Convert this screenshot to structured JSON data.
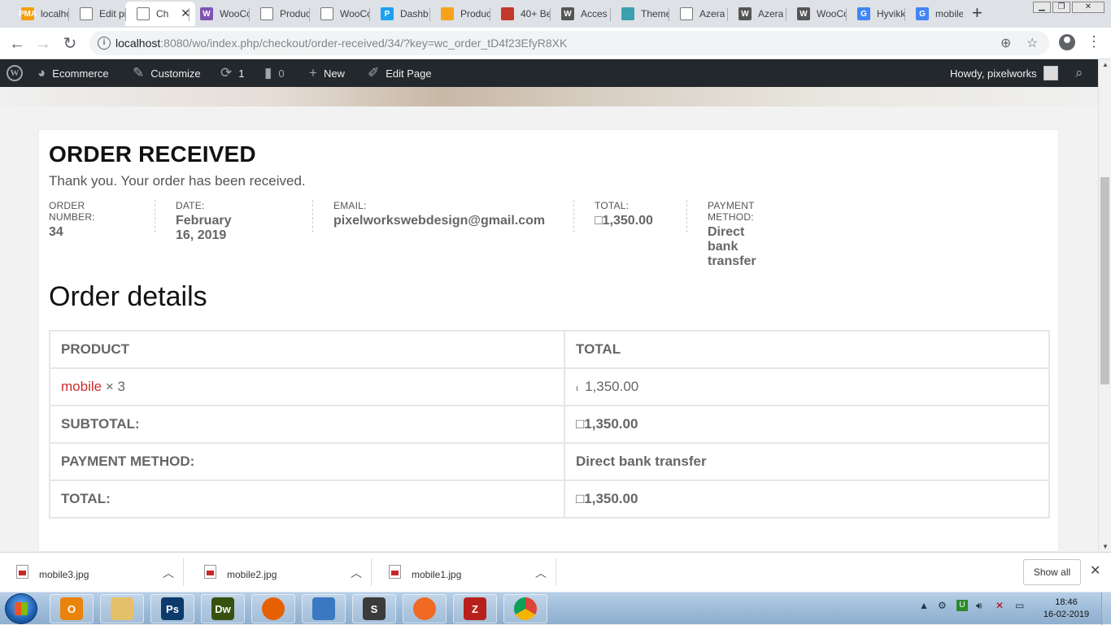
{
  "browser": {
    "tabs": [
      {
        "title": "localho",
        "icon": "PMA",
        "color": "#f59e0b"
      },
      {
        "title": "Edit pro",
        "icon": "",
        "color": "#ffffff"
      },
      {
        "title": "Ch",
        "icon": "",
        "color": "#ffffff",
        "active": true
      },
      {
        "title": "WooCo",
        "icon": "W",
        "color": "#7f54b3"
      },
      {
        "title": "Produc",
        "icon": "",
        "color": "#ffffff"
      },
      {
        "title": "WooCo",
        "icon": "",
        "color": "#ffffff"
      },
      {
        "title": "Dashb",
        "icon": "P",
        "color": "#1da1f2"
      },
      {
        "title": "Produc",
        "icon": "",
        "color": "#f6a21b"
      },
      {
        "title": "40+ Be",
        "icon": "",
        "color": "#c0392b"
      },
      {
        "title": "Acces",
        "icon": "W",
        "color": "#555555"
      },
      {
        "title": "Theme",
        "icon": "",
        "color": "#3aa0b0"
      },
      {
        "title": "Azera",
        "icon": "",
        "color": "#ffffff"
      },
      {
        "title": "Azera",
        "icon": "W",
        "color": "#555555"
      },
      {
        "title": "WooCo",
        "icon": "W",
        "color": "#555555"
      },
      {
        "title": "Hyvikk",
        "icon": "G",
        "color": "#4285f4"
      },
      {
        "title": "mobile",
        "icon": "G",
        "color": "#4285f4"
      }
    ],
    "tab_close": "✕",
    "new_tab": "+",
    "window_controls": [
      "▁",
      "❐",
      "✕"
    ],
    "url_host": "localhost",
    "url_rest": ":8080/wo/index.php/checkout/order-received/34/?key=wc_order_tD4f23EfyR8XK"
  },
  "adminbar": {
    "site_name": "Ecommerce",
    "customize": "Customize",
    "updates_count": "1",
    "comments_count": "0",
    "new_label": "New",
    "edit_page": "Edit Page",
    "howdy": "Howdy, pixelworks"
  },
  "order": {
    "title": "ORDER RECEIVED",
    "thanks": "Thank you. Your order has been received.",
    "overview": [
      {
        "label": "ORDER NUMBER:",
        "value": "34"
      },
      {
        "label": "DATE:",
        "value": "February 16, 2019"
      },
      {
        "label": "EMAIL:",
        "value": "pixelworkswebdesign@gmail.com"
      },
      {
        "label": "TOTAL:",
        "value": "□1,350.00"
      },
      {
        "label": "PAYMENT METHOD:",
        "value": "Direct bank transfer"
      }
    ]
  },
  "details": {
    "title": "Order details",
    "col_product": "PRODUCT",
    "col_total": "TOTAL",
    "item_name": "mobile",
    "item_qty": "× 3",
    "item_currency": "ı",
    "item_total": "1,350.00",
    "rows": [
      {
        "label": "SUBTOTAL:",
        "value": "□1,350.00",
        "bold": true
      },
      {
        "label": "PAYMENT METHOD:",
        "value": "Direct bank transfer",
        "bold": true
      },
      {
        "label": "TOTAL:",
        "value": "□1,350.00",
        "bold": true
      }
    ]
  },
  "downloads": {
    "items": [
      "mobile3.jpg",
      "mobile2.jpg",
      "mobile1.jpg"
    ],
    "show_all": "Show all"
  },
  "taskbar": {
    "apps": [
      {
        "name": "outlook",
        "label": "O",
        "color": "#e8830c"
      },
      {
        "name": "explorer",
        "label": "",
        "color": "#e5c06b"
      },
      {
        "name": "photoshop",
        "label": "Ps",
        "color": "#0b3a6b"
      },
      {
        "name": "dreamweaver",
        "label": "Dw",
        "color": "#35520f"
      },
      {
        "name": "firefox",
        "label": "",
        "color": "#e66000"
      },
      {
        "name": "network",
        "label": "",
        "color": "#3b78c2"
      },
      {
        "name": "sublime",
        "label": "S",
        "color": "#3b3b3b"
      },
      {
        "name": "pen",
        "label": "",
        "color": "#f06a24"
      },
      {
        "name": "filezilla",
        "label": "Z",
        "color": "#b8201c"
      },
      {
        "name": "chrome",
        "label": "",
        "color": "#ffffff"
      }
    ],
    "time": "18:46",
    "date": "16-02-2019"
  }
}
